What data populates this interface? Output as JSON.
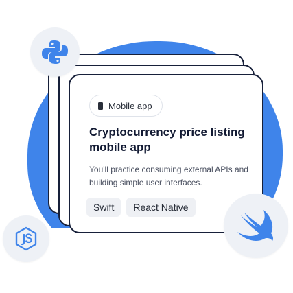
{
  "card": {
    "tag_label": "Mobile app",
    "title": "Cryptocurrency price listing mobile app",
    "description": "You'll practice consuming external APIs and building simple user interfaces.",
    "chips": [
      "Swift",
      "React Native"
    ]
  },
  "colors": {
    "accent_blue": "#3f84ea",
    "card_border": "#17203a",
    "badge_bg": "#eef1f6"
  },
  "icons": [
    "python-icon",
    "nodejs-icon",
    "swift-icon",
    "phone-icon"
  ]
}
